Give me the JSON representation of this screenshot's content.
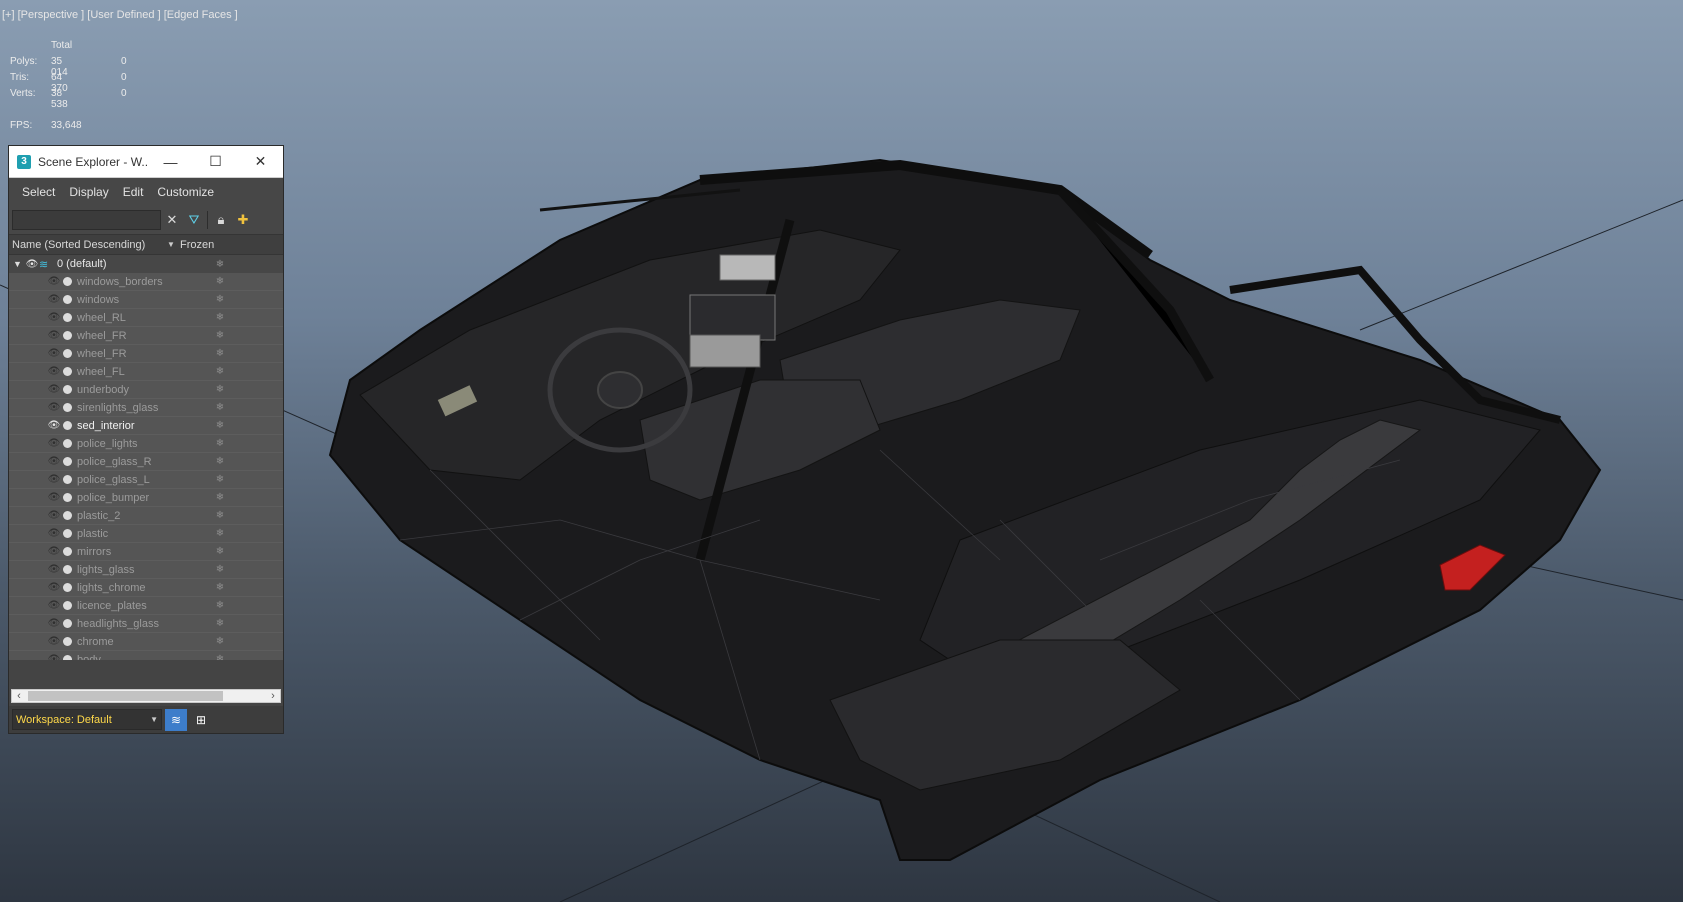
{
  "viewport": {
    "label": "[+] [Perspective ] [User Defined ] [Edged Faces ]",
    "stats": {
      "header": "Total",
      "rows": [
        {
          "label": "Polys:",
          "total": "35 014",
          "selected": "0"
        },
        {
          "label": "Tris:",
          "total": "64 370",
          "selected": "0"
        },
        {
          "label": "Verts:",
          "total": "38 538",
          "selected": "0"
        }
      ],
      "fps_label": "FPS:",
      "fps_value": "33,648"
    }
  },
  "scene_explorer": {
    "title": "Scene Explorer - W...",
    "logo": "3",
    "menus": [
      "Select",
      "Display",
      "Edit",
      "Customize"
    ],
    "search": {
      "value": "",
      "placeholder": ""
    },
    "columns": {
      "name": "Name (Sorted Descending)",
      "frozen": "Frozen"
    },
    "layer": {
      "name": "0 (default)"
    },
    "objects": [
      {
        "name": "windows_borders",
        "visible": false
      },
      {
        "name": "windows",
        "visible": false
      },
      {
        "name": "wheel_RL",
        "visible": false
      },
      {
        "name": "wheel_FR",
        "visible": false
      },
      {
        "name": "wheel_FR",
        "visible": false
      },
      {
        "name": "wheel_FL",
        "visible": false
      },
      {
        "name": "underbody",
        "visible": false
      },
      {
        "name": "sirenlights_glass",
        "visible": false
      },
      {
        "name": "sed_interior",
        "visible": true
      },
      {
        "name": "police_lights",
        "visible": false
      },
      {
        "name": "police_glass_R",
        "visible": false
      },
      {
        "name": "police_glass_L",
        "visible": false
      },
      {
        "name": "police_bumper",
        "visible": false
      },
      {
        "name": "plastic_2",
        "visible": false
      },
      {
        "name": "plastic",
        "visible": false
      },
      {
        "name": "mirrors",
        "visible": false
      },
      {
        "name": "lights_glass",
        "visible": false
      },
      {
        "name": "lights_chrome",
        "visible": false
      },
      {
        "name": "licence_plates",
        "visible": false
      },
      {
        "name": "headlights_glass",
        "visible": false
      },
      {
        "name": "chrome",
        "visible": false
      },
      {
        "name": "body",
        "visible": false
      }
    ],
    "workspace": "Workspace: Default"
  },
  "icons": {
    "minimize": "minimize-icon",
    "maximize": "maximize-icon",
    "close": "close-icon",
    "clear": "clear-search-icon",
    "filter": "filter-icon",
    "lock": "lock-icon",
    "add": "add-layer-icon",
    "eye": "eye-icon",
    "freeze": "snowflake-icon"
  }
}
